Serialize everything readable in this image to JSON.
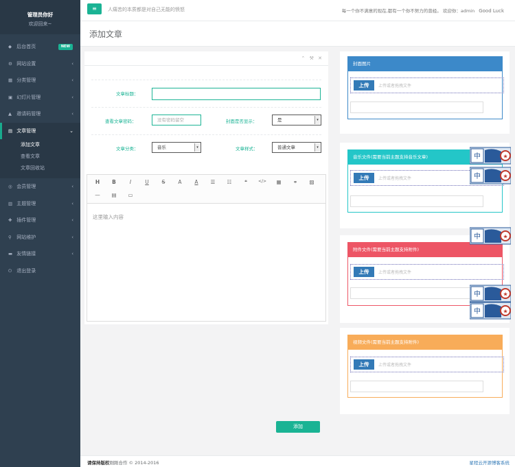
{
  "profile": {
    "name": "管理员你好",
    "sub": "欢迎回来~"
  },
  "sidebar": {
    "items": [
      {
        "icon": "◆",
        "label": "后台首页",
        "badge": "NEW"
      },
      {
        "icon": "⚙",
        "label": "网站设置",
        "chev": "‹"
      },
      {
        "icon": "▦",
        "label": "分类管理",
        "chev": "‹"
      },
      {
        "icon": "▣",
        "label": "幻灯片管理",
        "chev": "‹"
      },
      {
        "icon": "▲",
        "label": "邀请码管理",
        "chev": "‹"
      },
      {
        "icon": "▤",
        "label": "文章管理",
        "chev": "⌄"
      }
    ],
    "sub_items": [
      "添加文章",
      "查看文章",
      "文章回收站"
    ],
    "items2": [
      {
        "icon": "◎",
        "label": "会员管理",
        "chev": "‹"
      },
      {
        "icon": "▥",
        "label": "主题管理",
        "chev": "‹"
      },
      {
        "icon": "✚",
        "label": "插件管理",
        "chev": "‹"
      },
      {
        "icon": "⚲",
        "label": "网站维护",
        "chev": "‹"
      },
      {
        "icon": "▬",
        "label": "友情链接",
        "chev": "‹"
      },
      {
        "icon": "⏻",
        "label": "退出登录"
      }
    ]
  },
  "topbar": {
    "menu_icon": "≡",
    "motto": "人痛苦的本质都是对自己无能的愤怒",
    "right_text": "每一个你不满意的现在,都有一个你不努力的曾经。 欢迎你：admin",
    "good_luck": "Good Luck"
  },
  "heading": "添加文章",
  "form": {
    "tools": "⌃ ⚒ ✕",
    "title_label": "文章标题：",
    "title_value": "",
    "password_label": "查看文章密码：",
    "password_placeholder": "没有密码留空",
    "cover_label": "封面是否显示：",
    "cover_value": "是",
    "category_label": "文章分类：",
    "category_value": "音乐",
    "style_label": "文章样式：",
    "style_value": "普通文章",
    "select_arrow": "▾",
    "editor_placeholder": "这里输入内容",
    "toolbar": [
      "H",
      "B",
      "I",
      "U",
      "S",
      "A",
      "A",
      "☰",
      "☷",
      "❝",
      "</>",
      "▦",
      "⚭",
      "▨",
      "—",
      "▤",
      "▭"
    ]
  },
  "uploads": [
    {
      "title": "封面图片",
      "color": "#3c89c9",
      "button": "上传",
      "hint": "上传或者拖拽文件"
    },
    {
      "title": "音乐文件(需要当前主题支持音乐文章)",
      "color": "#23c6c8",
      "button": "上传",
      "hint": "上传或者拖拽文件"
    },
    {
      "title": "附件文件(需要当前主题支持附件)",
      "color": "#ed5565",
      "button": "上传",
      "hint": "上传或者拖拽文件"
    },
    {
      "title": "视频文件(需要当前主题支持附件)",
      "color": "#f8ac59",
      "button": "上传",
      "hint": "上传或者拖拽文件"
    }
  ],
  "sticker_text": "中",
  "add_button": "添加",
  "footer": {
    "bold": "请保持版权",
    "rest": "刚刚合作 © 2014-2016",
    "right": "星程云开源博客系统"
  }
}
